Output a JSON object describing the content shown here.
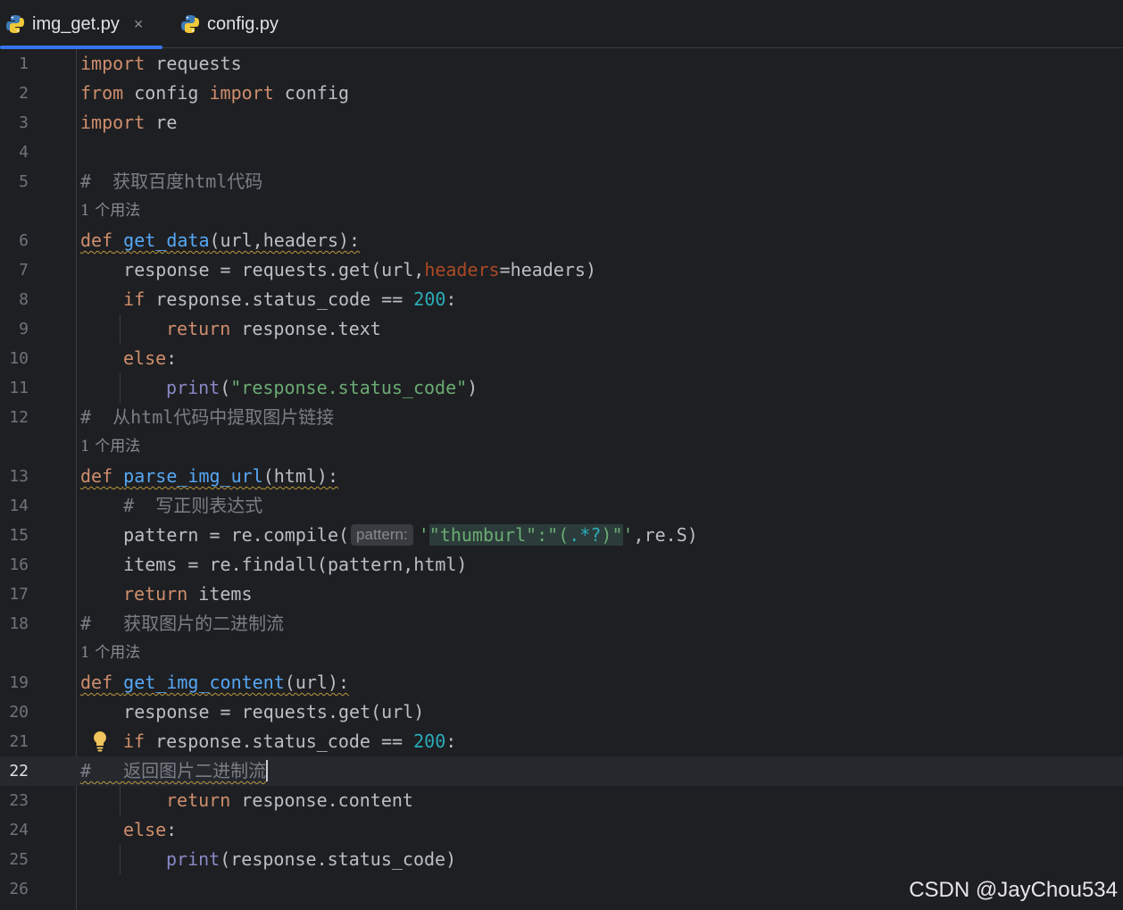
{
  "tabs": [
    {
      "label": "img_get.py",
      "active": true,
      "close": "×"
    },
    {
      "label": "config.py",
      "active": false
    }
  ],
  "usage_hint": "1 个用法",
  "code": {
    "l1": {
      "n": "1",
      "a": "import",
      "b": " requests"
    },
    "l2": {
      "n": "2",
      "a": "from",
      "b": " config ",
      "c": "import",
      "d": " config"
    },
    "l3": {
      "n": "3",
      "a": "import",
      "b": " re"
    },
    "l4": {
      "n": "4"
    },
    "l5": {
      "n": "5",
      "a": "#  获取百度html代码"
    },
    "l6": {
      "n": "6",
      "a": "def",
      "b": "get_data",
      "c": "(url,headers):"
    },
    "l7": {
      "n": "7",
      "a": "    response = requests.get(url,",
      "b": "headers",
      "c": "=headers)"
    },
    "l8": {
      "n": "8",
      "a": "    ",
      "b": "if",
      "c": " response.status_code == ",
      "d": "200",
      "e": ":"
    },
    "l9": {
      "n": "9",
      "a": "return",
      "b": " response.text"
    },
    "l10": {
      "n": "10",
      "a": "else",
      "b": ":"
    },
    "l11": {
      "n": "11",
      "a": "print",
      "b": "(",
      "c": "\"response.status_code\"",
      "d": ")"
    },
    "l12": {
      "n": "12",
      "a": "#  从html代码中提取图片链接"
    },
    "l13": {
      "n": "13",
      "a": "def",
      "b": "parse_img_url",
      "c": "(html):"
    },
    "l14": {
      "n": "14",
      "a": "    #  写正则表达式"
    },
    "l15": {
      "n": "15",
      "a": "    pattern = re.compile(",
      "inlay": "pattern:",
      "b": "'",
      "c": "\"thumburl\":\"(",
      "d": ".*?",
      "e": ")\"",
      "f": "'",
      "g": ",re.S)"
    },
    "l16": {
      "n": "16",
      "a": "    items = re.findall(pattern,html)"
    },
    "l17": {
      "n": "17",
      "a": "return",
      "b": " items"
    },
    "l18": {
      "n": "18",
      "a": "#   获取图片的二进制流"
    },
    "l19": {
      "n": "19",
      "a": "def",
      "b": "get_img_content",
      "c": "(url):"
    },
    "l20": {
      "n": "20",
      "a": "    response = requests.get(url)"
    },
    "l21": {
      "n": "21",
      "a": "if",
      "b": " response.status_code == ",
      "c": "200",
      "d": ":"
    },
    "l22": {
      "n": "22",
      "a": "#   返回图片二进制流"
    },
    "l23": {
      "n": "23",
      "a": "return",
      "b": " response.content"
    },
    "l24": {
      "n": "24",
      "a": "else",
      "b": ":"
    },
    "l25": {
      "n": "25",
      "a": "print",
      "b": "(response.status_code)"
    },
    "l26": {
      "n": "26"
    }
  },
  "watermark": "CSDN @JayChou534",
  "colors": {
    "keyword": "#cf8e6d",
    "function": "#56a8f5",
    "number": "#2aacb8",
    "string": "#6aab73",
    "comment": "#7a7e85",
    "accent": "#3574f0"
  },
  "icons": {
    "file": "python-file-icon",
    "hint": "lightbulb-icon",
    "close": "close-icon"
  }
}
